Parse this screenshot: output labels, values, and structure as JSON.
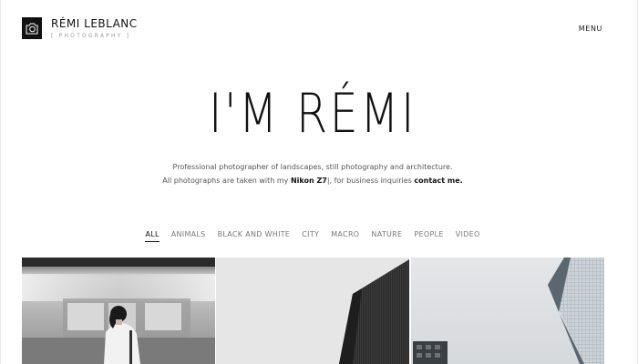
{
  "header": {
    "brand_name": "RÉMI LEBLANC",
    "brand_sub": "[ PHOTOGRAPHY ]",
    "menu_label": "MENU"
  },
  "hero": {
    "title": "I'M RÉMI",
    "line1": "Professional photographer of landscapes, still photography and architecture.",
    "line2_pre": "All photographs are taken with my ",
    "camera": "Nikon Z7",
    "line2_mid": "|, for business inquiries ",
    "contact": "contact me."
  },
  "filters": [
    {
      "label": "ALL",
      "active": true
    },
    {
      "label": "ANIMALS",
      "active": false
    },
    {
      "label": "BLACK AND WHITE",
      "active": false
    },
    {
      "label": "CITY",
      "active": false
    },
    {
      "label": "MACRO",
      "active": false
    },
    {
      "label": "NATURE",
      "active": false
    },
    {
      "label": "PEOPLE",
      "active": false
    },
    {
      "label": "VIDEO",
      "active": false
    }
  ],
  "gallery": {
    "items": [
      {
        "subject": "woman-at-subway"
      },
      {
        "subject": "dark-skyscraper"
      },
      {
        "subject": "glass-tower"
      }
    ]
  },
  "colors": {
    "text": "#111111",
    "muted": "#777777",
    "logo_bg": "#111111"
  },
  "icons": {
    "logo": "camera-logo-icon"
  }
}
